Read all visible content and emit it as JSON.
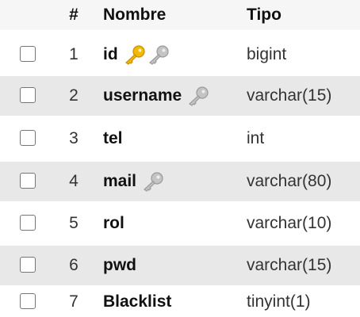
{
  "header": {
    "num": "#",
    "name": "Nombre",
    "type": "Tipo"
  },
  "colors": {
    "primary_key": "#f5b800",
    "index_key": "#b8b8b8",
    "row_alt": "#e8e8e8",
    "header_bg": "#f6f6f6"
  },
  "rows": [
    {
      "num": "1",
      "name": "id",
      "type": "bigint",
      "icons": [
        "primary-key-icon",
        "index-key-icon"
      ]
    },
    {
      "num": "2",
      "name": "username",
      "type": "varchar(15)",
      "icons": [
        "index-key-icon"
      ]
    },
    {
      "num": "3",
      "name": "tel",
      "type": "int",
      "icons": []
    },
    {
      "num": "4",
      "name": "mail",
      "type": "varchar(80)",
      "icons": [
        "index-key-icon"
      ]
    },
    {
      "num": "5",
      "name": "rol",
      "type": "varchar(10)",
      "icons": []
    },
    {
      "num": "6",
      "name": "pwd",
      "type": "varchar(15)",
      "icons": []
    },
    {
      "num": "7",
      "name": "Blacklist",
      "type": "tinyint(1)",
      "icons": []
    }
  ]
}
